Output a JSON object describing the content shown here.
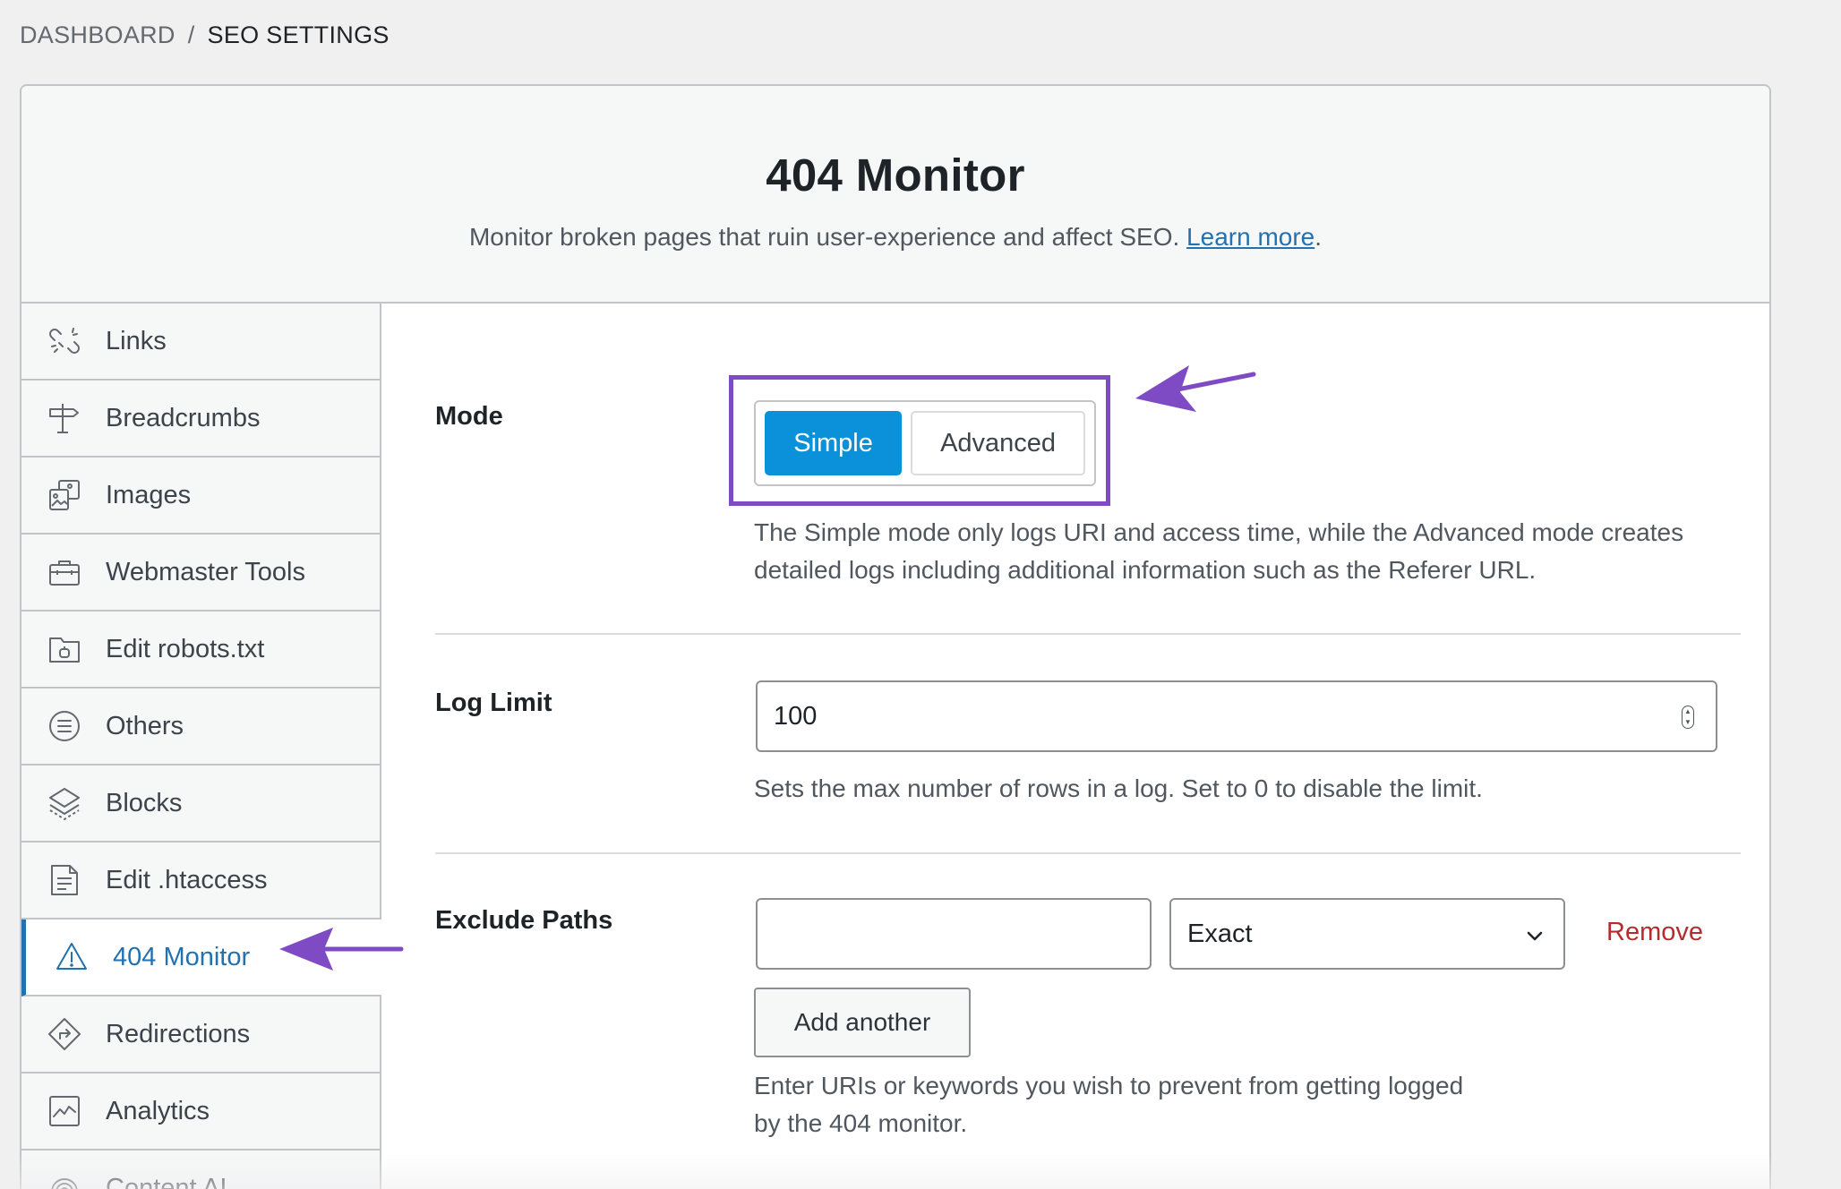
{
  "breadcrumb": {
    "parent": "DASHBOARD",
    "separator": "/",
    "current": "SEO SETTINGS"
  },
  "header": {
    "title": "404 Monitor",
    "subtitle_text": "Monitor broken pages that ruin user-experience and affect SEO. ",
    "learn_more": "Learn more",
    "period": "."
  },
  "sidebar": {
    "items": [
      {
        "label": "Links",
        "icon": "link-broken-icon"
      },
      {
        "label": "Breadcrumbs",
        "icon": "signpost-icon"
      },
      {
        "label": "Images",
        "icon": "images-icon"
      },
      {
        "label": "Webmaster Tools",
        "icon": "toolbox-icon"
      },
      {
        "label": "Edit robots.txt",
        "icon": "folder-robot-icon"
      },
      {
        "label": "Others",
        "icon": "list-circle-icon"
      },
      {
        "label": "Blocks",
        "icon": "blocks-icon"
      },
      {
        "label": "Edit .htaccess",
        "icon": "file-text-icon"
      },
      {
        "label": "404 Monitor",
        "icon": "warning-triangle-icon",
        "active": true
      },
      {
        "label": "Redirections",
        "icon": "redirect-diamond-icon"
      },
      {
        "label": "Analytics",
        "icon": "analytics-chart-icon"
      },
      {
        "label": "Content AI",
        "icon": "content-ai-icon"
      }
    ]
  },
  "mode": {
    "label": "Mode",
    "options": [
      "Simple",
      "Advanced"
    ],
    "selected": "Simple",
    "description": "The Simple mode only logs URI and access time, while the Advanced mode creates detailed logs including additional information such as the Referer URL."
  },
  "log_limit": {
    "label": "Log Limit",
    "value": "100",
    "description": "Sets the max number of rows in a log. Set to 0 to disable the limit."
  },
  "exclude_paths": {
    "label": "Exclude Paths",
    "path_value": "",
    "match_type": "Exact",
    "remove_label": "Remove",
    "add_label": "Add another",
    "description": "Enter URIs or keywords you wish to prevent from getting logged by the 404 monitor."
  },
  "colors": {
    "accent": "#0b91da",
    "active_link": "#2271b1",
    "annotation": "#7e4bc4",
    "danger": "#b32d2e"
  }
}
